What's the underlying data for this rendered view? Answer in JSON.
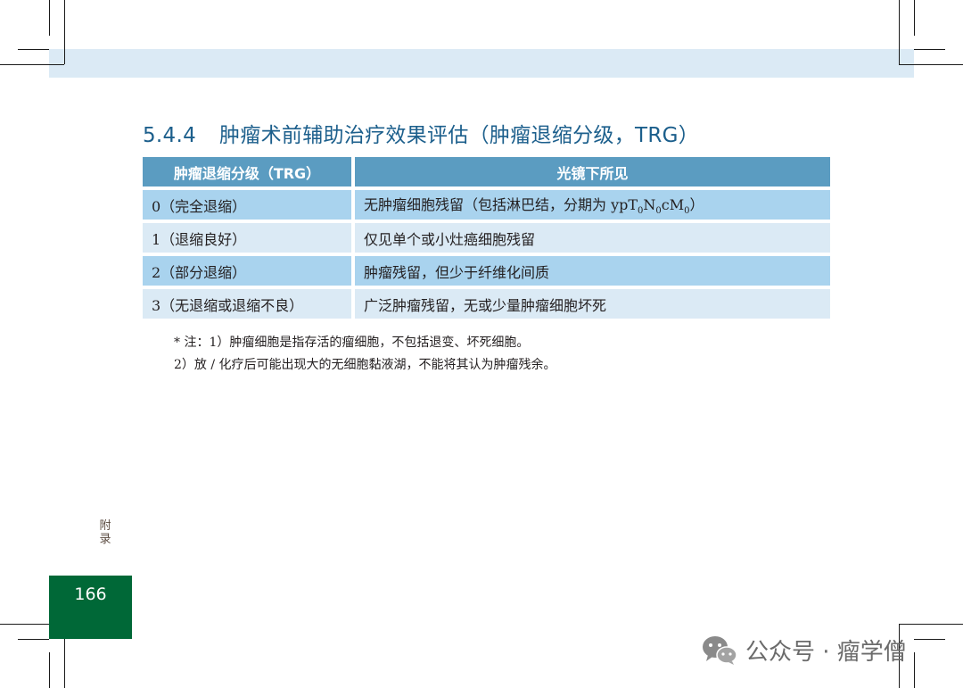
{
  "section": {
    "number": "5.4.4",
    "title": "肿瘤术前辅助治疗效果评估（肿瘤退缩分级，TRG）"
  },
  "table": {
    "headers": [
      "肿瘤退缩分级（TRG）",
      "光镜下所见"
    ],
    "rows": [
      {
        "grade": "0（完全退缩）",
        "finding": "无肿瘤细胞残留（包括淋巴结，分期为 ",
        "finding_stage": {
          "a": "ypT",
          "b": "0",
          "c": "N",
          "d": "0",
          "e": "cM",
          "f": "0"
        },
        "finding_end": "）"
      },
      {
        "grade": "1（退缩良好）",
        "finding": "仅见单个或小灶癌细胞残留"
      },
      {
        "grade": "2（部分退缩）",
        "finding": "肿瘤残留，但少于纤维化间质"
      },
      {
        "grade": "3（无退缩或退缩不良）",
        "finding": "广泛肿瘤残留，无或少量肿瘤细胞坏死"
      }
    ]
  },
  "notes": {
    "line1": "* 注：1）肿瘤细胞是指存活的瘤细胞，不包括退变、坏死细胞。",
    "line2": "2）放 / 化疗后可能出现大的无细胞黏液湖，不能将其认为肿瘤残余。"
  },
  "side_label": {
    "line1": "附",
    "line2": "录"
  },
  "page_number": "166",
  "watermark": "公众号 · 瘤学僧",
  "colors": {
    "header_bg": "#5b9cc1",
    "row_dark": "#a9d3ee",
    "row_light": "#dbeaf5",
    "title": "#1c5f8c",
    "page_box": "#006837"
  }
}
